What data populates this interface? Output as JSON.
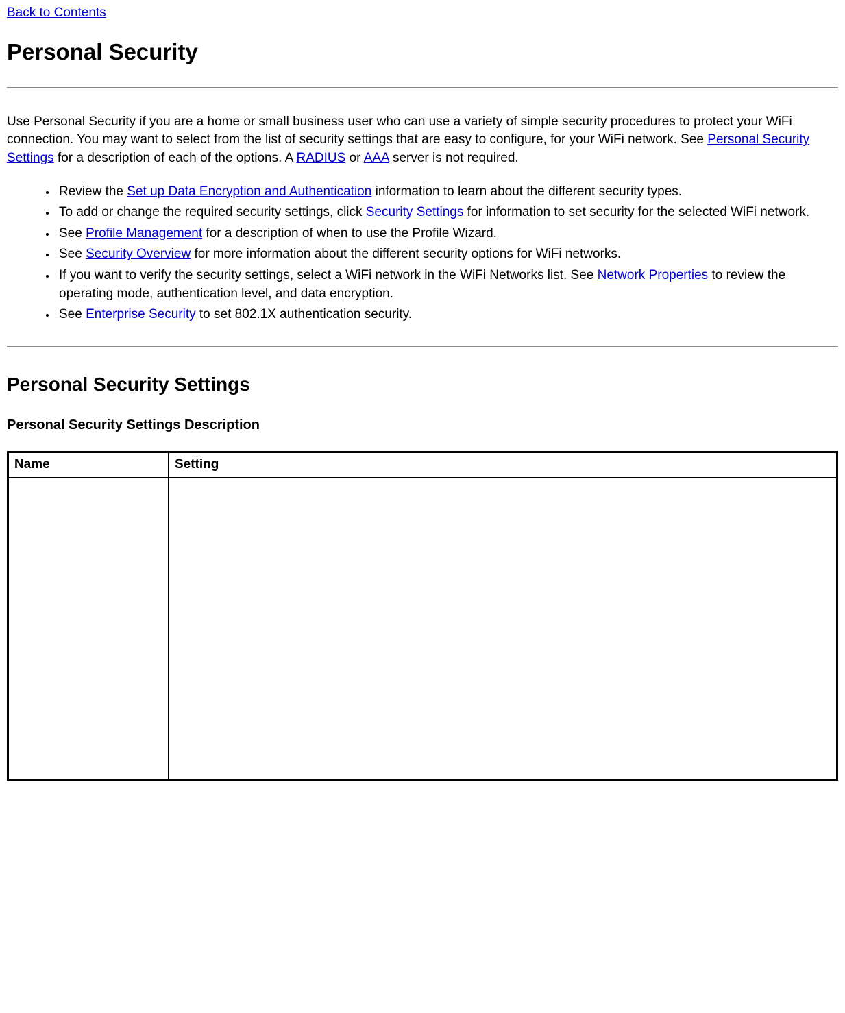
{
  "topLink": "Back to Contents",
  "heading1": "Personal Security",
  "intro": {
    "pre1": "Use Personal Security if you are a home or small business user who can use a variety of simple security procedures to protect your WiFi connection. You may want to select from the list of security settings that are easy to configure, for your WiFi network. See ",
    "link1": "Personal Security Settings",
    "mid1": " for a description of each of the options. A ",
    "link2": "RADIUS",
    "mid2": " or ",
    "link3": "AAA",
    "post": " server is not required."
  },
  "bullets": {
    "b1": {
      "pre": "Review the ",
      "link": "Set up Data Encryption and Authentication",
      "post": " information to learn about the different security types."
    },
    "b2": {
      "pre": "To add or change the required security settings, click ",
      "link": "Security Settings",
      "post": " for information to set security for the selected WiFi network."
    },
    "b3": {
      "pre": "See ",
      "link": "Profile Management",
      "post": " for a description of when to use the Profile Wizard."
    },
    "b4": {
      "pre": "See ",
      "link": "Security Overview",
      "post": " for more information about the different security options for WiFi networks."
    },
    "b5": {
      "pre": "If you want to verify the security settings, select a WiFi network in the WiFi Networks list. See ",
      "link": "Network Properties",
      "post": " to review the operating mode, authentication level, and data encryption."
    },
    "b6": {
      "pre": "See ",
      "link": "Enterprise Security",
      "post": " to set 802.1X authentication security."
    }
  },
  "heading2": "Personal Security Settings",
  "heading3": "Personal Security Settings Description",
  "table": {
    "col1": "Name",
    "col2": "Setting"
  }
}
